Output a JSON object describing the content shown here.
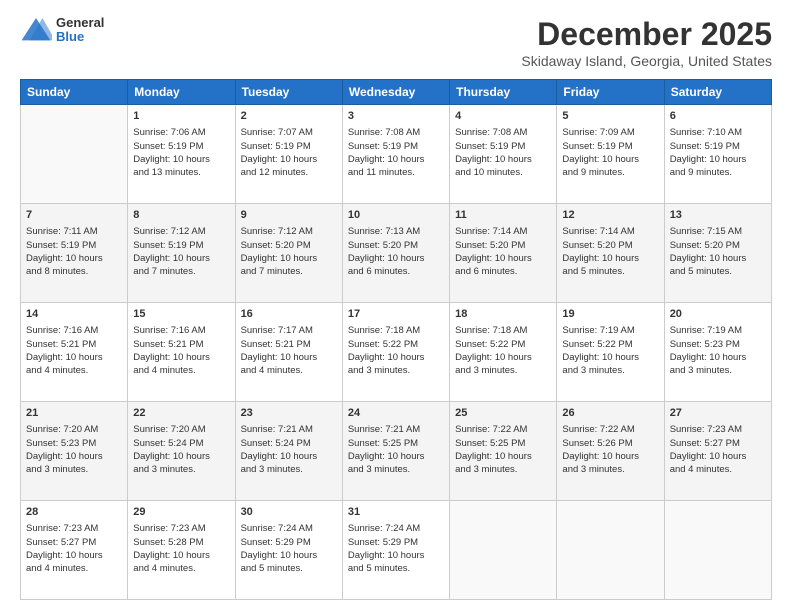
{
  "logo": {
    "general": "General",
    "blue": "Blue"
  },
  "header": {
    "title": "December 2025",
    "location": "Skidaway Island, Georgia, United States"
  },
  "days_of_week": [
    "Sunday",
    "Monday",
    "Tuesday",
    "Wednesday",
    "Thursday",
    "Friday",
    "Saturday"
  ],
  "weeks": [
    [
      {
        "day": "",
        "content": ""
      },
      {
        "day": "1",
        "content": "Sunrise: 7:06 AM\nSunset: 5:19 PM\nDaylight: 10 hours\nand 13 minutes."
      },
      {
        "day": "2",
        "content": "Sunrise: 7:07 AM\nSunset: 5:19 PM\nDaylight: 10 hours\nand 12 minutes."
      },
      {
        "day": "3",
        "content": "Sunrise: 7:08 AM\nSunset: 5:19 PM\nDaylight: 10 hours\nand 11 minutes."
      },
      {
        "day": "4",
        "content": "Sunrise: 7:08 AM\nSunset: 5:19 PM\nDaylight: 10 hours\nand 10 minutes."
      },
      {
        "day": "5",
        "content": "Sunrise: 7:09 AM\nSunset: 5:19 PM\nDaylight: 10 hours\nand 9 minutes."
      },
      {
        "day": "6",
        "content": "Sunrise: 7:10 AM\nSunset: 5:19 PM\nDaylight: 10 hours\nand 9 minutes."
      }
    ],
    [
      {
        "day": "7",
        "content": "Sunrise: 7:11 AM\nSunset: 5:19 PM\nDaylight: 10 hours\nand 8 minutes."
      },
      {
        "day": "8",
        "content": "Sunrise: 7:12 AM\nSunset: 5:19 PM\nDaylight: 10 hours\nand 7 minutes."
      },
      {
        "day": "9",
        "content": "Sunrise: 7:12 AM\nSunset: 5:20 PM\nDaylight: 10 hours\nand 7 minutes."
      },
      {
        "day": "10",
        "content": "Sunrise: 7:13 AM\nSunset: 5:20 PM\nDaylight: 10 hours\nand 6 minutes."
      },
      {
        "day": "11",
        "content": "Sunrise: 7:14 AM\nSunset: 5:20 PM\nDaylight: 10 hours\nand 6 minutes."
      },
      {
        "day": "12",
        "content": "Sunrise: 7:14 AM\nSunset: 5:20 PM\nDaylight: 10 hours\nand 5 minutes."
      },
      {
        "day": "13",
        "content": "Sunrise: 7:15 AM\nSunset: 5:20 PM\nDaylight: 10 hours\nand 5 minutes."
      }
    ],
    [
      {
        "day": "14",
        "content": "Sunrise: 7:16 AM\nSunset: 5:21 PM\nDaylight: 10 hours\nand 4 minutes."
      },
      {
        "day": "15",
        "content": "Sunrise: 7:16 AM\nSunset: 5:21 PM\nDaylight: 10 hours\nand 4 minutes."
      },
      {
        "day": "16",
        "content": "Sunrise: 7:17 AM\nSunset: 5:21 PM\nDaylight: 10 hours\nand 4 minutes."
      },
      {
        "day": "17",
        "content": "Sunrise: 7:18 AM\nSunset: 5:22 PM\nDaylight: 10 hours\nand 3 minutes."
      },
      {
        "day": "18",
        "content": "Sunrise: 7:18 AM\nSunset: 5:22 PM\nDaylight: 10 hours\nand 3 minutes."
      },
      {
        "day": "19",
        "content": "Sunrise: 7:19 AM\nSunset: 5:22 PM\nDaylight: 10 hours\nand 3 minutes."
      },
      {
        "day": "20",
        "content": "Sunrise: 7:19 AM\nSunset: 5:23 PM\nDaylight: 10 hours\nand 3 minutes."
      }
    ],
    [
      {
        "day": "21",
        "content": "Sunrise: 7:20 AM\nSunset: 5:23 PM\nDaylight: 10 hours\nand 3 minutes."
      },
      {
        "day": "22",
        "content": "Sunrise: 7:20 AM\nSunset: 5:24 PM\nDaylight: 10 hours\nand 3 minutes."
      },
      {
        "day": "23",
        "content": "Sunrise: 7:21 AM\nSunset: 5:24 PM\nDaylight: 10 hours\nand 3 minutes."
      },
      {
        "day": "24",
        "content": "Sunrise: 7:21 AM\nSunset: 5:25 PM\nDaylight: 10 hours\nand 3 minutes."
      },
      {
        "day": "25",
        "content": "Sunrise: 7:22 AM\nSunset: 5:25 PM\nDaylight: 10 hours\nand 3 minutes."
      },
      {
        "day": "26",
        "content": "Sunrise: 7:22 AM\nSunset: 5:26 PM\nDaylight: 10 hours\nand 3 minutes."
      },
      {
        "day": "27",
        "content": "Sunrise: 7:23 AM\nSunset: 5:27 PM\nDaylight: 10 hours\nand 4 minutes."
      }
    ],
    [
      {
        "day": "28",
        "content": "Sunrise: 7:23 AM\nSunset: 5:27 PM\nDaylight: 10 hours\nand 4 minutes."
      },
      {
        "day": "29",
        "content": "Sunrise: 7:23 AM\nSunset: 5:28 PM\nDaylight: 10 hours\nand 4 minutes."
      },
      {
        "day": "30",
        "content": "Sunrise: 7:24 AM\nSunset: 5:29 PM\nDaylight: 10 hours\nand 5 minutes."
      },
      {
        "day": "31",
        "content": "Sunrise: 7:24 AM\nSunset: 5:29 PM\nDaylight: 10 hours\nand 5 minutes."
      },
      {
        "day": "",
        "content": ""
      },
      {
        "day": "",
        "content": ""
      },
      {
        "day": "",
        "content": ""
      }
    ]
  ]
}
